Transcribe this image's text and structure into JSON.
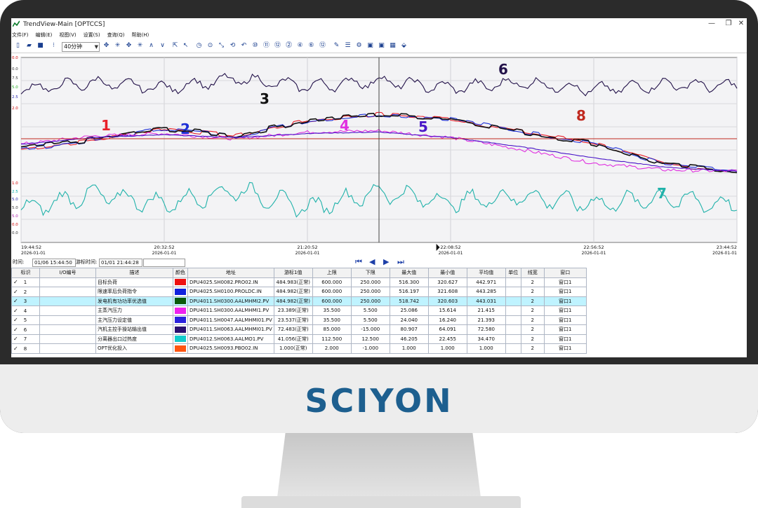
{
  "brand": {
    "logo_text": "SCIYON"
  },
  "window": {
    "title": "TrendView-Main [OPTCCS]",
    "controls": [
      "—",
      "❐",
      "✕"
    ]
  },
  "menu": [
    "文件(F)",
    "编辑(E)",
    "视图(V)",
    "设置(S)",
    "查询(Q)",
    "帮助(H)"
  ],
  "toolbar": {
    "interval": "40分钟",
    "glyphs": [
      "▯",
      "▰",
      "■",
      "⁝",
      "✥",
      "✳",
      "✥",
      "✳",
      "∧",
      "∨",
      "⇱",
      "↖",
      "◷",
      "⊙",
      "⤡",
      "⟲",
      "↶",
      "⑩",
      "⑪",
      "⑫",
      "⓶",
      "④",
      "⑥",
      "⑫",
      "✎",
      "☰",
      "⚙",
      "▣",
      "▣",
      "▦",
      "⬙"
    ]
  },
  "chart_data": {
    "type": "line",
    "x": [
      "19:44:52",
      "20:32:52",
      "21:20:52",
      "22:08:52",
      "22:56:52",
      "23:44:52"
    ],
    "x_dates": [
      "2026-01-01",
      "2026-01-01",
      "2026-01-01",
      "2026-01-01",
      "2026-01-01",
      "2026-01-01"
    ],
    "series": [
      {
        "name": "1",
        "color": "#e8202a",
        "values": [
          440,
          460,
          488,
          470,
          505,
          520,
          510,
          480,
          455,
          405,
          390
        ]
      },
      {
        "name": "2",
        "color": "#1d2fd6",
        "values": [
          440,
          460,
          488,
          470,
          505,
          520,
          510,
          480,
          455,
          405,
          390
        ]
      },
      {
        "name": "3",
        "color": "#111111",
        "values": [
          442,
          462,
          487,
          471,
          506,
          519,
          511,
          479,
          454,
          404,
          391
        ]
      },
      {
        "name": "4",
        "color": "#e030e0",
        "values": [
          21.0,
          21.6,
          21.8,
          21.4,
          21.9,
          22.0,
          21.5,
          20.6,
          19.6,
          19.1,
          19.0
        ]
      },
      {
        "name": "5",
        "color": "#4a16c8",
        "values": [
          21.0,
          21.5,
          21.7,
          21.5,
          21.8,
          21.9,
          21.5,
          20.8,
          20.0,
          19.3,
          19.0
        ]
      },
      {
        "name": "6",
        "color": "#23124a",
        "values": [
          72,
          76,
          73,
          78,
          74,
          77,
          73,
          76,
          72,
          75,
          74
        ]
      },
      {
        "name": "7",
        "color": "#20b2aa",
        "values": [
          30,
          38,
          33,
          40,
          31,
          39,
          34,
          37,
          33,
          36,
          32
        ]
      },
      {
        "name": "8",
        "color": "#c0281e",
        "values": [
          1,
          1,
          1,
          1,
          1,
          1,
          1,
          1,
          1,
          1,
          1
        ]
      }
    ],
    "left_axis_ticks": [
      "0.0",
      "0.0",
      "7.5",
      "5.0",
      "2.5",
      "2.0",
      "1.0",
      "2.5",
      "5.0",
      "5.0",
      "5.0",
      "0.0",
      "0.0"
    ],
    "grid": true
  },
  "timebar": {
    "start_label": "时间:",
    "start_value": "01/06 15:44:50",
    "end_label": "游标时间:",
    "end_value": "01/01 21:44:28",
    "extra_value": "",
    "nav": [
      "⏮",
      "◀",
      "▶",
      "⏭"
    ]
  },
  "table": {
    "headers": [
      "标识",
      "I/O编号",
      "描述",
      "颜色",
      "地址",
      "游标1值",
      "上限",
      "下限",
      "最大值",
      "最小值",
      "平均值",
      "单位",
      "线宽",
      "窗口"
    ],
    "check_mark": "✓",
    "rows": [
      {
        "id": "1",
        "io": "",
        "desc": "目标负荷",
        "color": "#ee1111",
        "addr": "DPU4025.SH0082.PRO02.IN",
        "cursor": "484.983(正常)",
        "hi": "600.000",
        "lo": "250.000",
        "max": "516.300",
        "min": "320.627",
        "avg": "442.971",
        "unit": "",
        "width": "2",
        "win": "窗口1"
      },
      {
        "id": "2",
        "io": "",
        "desc": "限速率后负荷指令",
        "color": "#1122dd",
        "addr": "DPU4025.SH0100.PROLDC.IN",
        "cursor": "484.982(正常)",
        "hi": "600.000",
        "lo": "250.000",
        "max": "516.197",
        "min": "321.608",
        "avg": "443.285",
        "unit": "",
        "width": "2",
        "win": "窗口1"
      },
      {
        "id": "3",
        "io": "",
        "desc": "发电机有功功率优选值",
        "color": "#0a5a0a",
        "addr": "DPU4011.SH0300.AALMHMI2.PV",
        "cursor": "484.982(正常)",
        "hi": "600.000",
        "lo": "250.000",
        "max": "518.742",
        "min": "320.603",
        "avg": "443.031",
        "unit": "",
        "width": "2",
        "win": "窗口1"
      },
      {
        "id": "4",
        "io": "",
        "desc": "主蒸汽压力",
        "color": "#ee22ee",
        "addr": "DPU4011.SH0300.AALMHMI1.PV",
        "cursor": "23.389(正常)",
        "hi": "35.500",
        "lo": "5.500",
        "max": "25.086",
        "min": "15.614",
        "avg": "21.415",
        "unit": "",
        "width": "2",
        "win": "窗口1"
      },
      {
        "id": "5",
        "io": "",
        "desc": "主汽压力设定值",
        "color": "#2a22dd",
        "addr": "DPU4011.SH0047.AALMHMI01.PV",
        "cursor": "23.537(正常)",
        "hi": "35.500",
        "lo": "5.500",
        "max": "24.040",
        "min": "16.240",
        "avg": "21.393",
        "unit": "",
        "width": "2",
        "win": "窗口1"
      },
      {
        "id": "6",
        "io": "",
        "desc": "汽机主控手操站输出值",
        "color": "#2a1070",
        "addr": "DPU4011.SH0063.AALMHMI01.PV",
        "cursor": "72.483(正常)",
        "hi": "85.000",
        "lo": "-15.000",
        "max": "80.907",
        "min": "64.091",
        "avg": "72.580",
        "unit": "",
        "width": "2",
        "win": "窗口1"
      },
      {
        "id": "7",
        "io": "",
        "desc": "分离器出口过热度",
        "color": "#11cccc",
        "addr": "DPU4012.SH0063.AALMO1.PV",
        "cursor": "41.056(正常)",
        "hi": "112.500",
        "lo": "12.500",
        "max": "46.205",
        "min": "22.455",
        "avg": "34.470",
        "unit": "",
        "width": "2",
        "win": "窗口1"
      },
      {
        "id": "8",
        "io": "",
        "desc": "OPT优化投入",
        "color": "#ff5511",
        "addr": "DPU4025.SH0093.PBO02.IN",
        "cursor": "1.000(正常)",
        "hi": "2.000",
        "lo": "-1.000",
        "max": "1.000",
        "min": "1.000",
        "avg": "1.000",
        "unit": "",
        "width": "2",
        "win": "窗口1"
      }
    ]
  }
}
